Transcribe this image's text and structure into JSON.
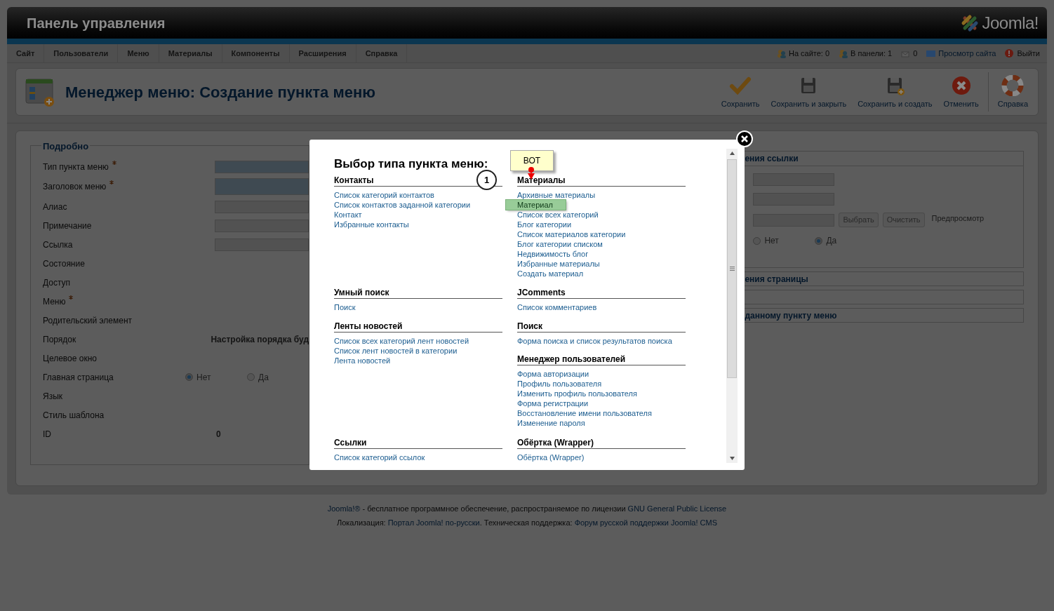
{
  "header": {
    "title": "Панель управления",
    "logo_text": "Joomla!"
  },
  "nav": [
    {
      "label": "Сайт"
    },
    {
      "label": "Пользователи"
    },
    {
      "label": "Меню"
    },
    {
      "label": "Материалы"
    },
    {
      "label": "Компоненты"
    },
    {
      "label": "Расширения"
    },
    {
      "label": "Справка"
    }
  ],
  "status": [
    {
      "kind": "users",
      "text": "На сайте: 0"
    },
    {
      "kind": "admins",
      "text": "В панели: 1"
    },
    {
      "kind": "messages",
      "text": "0"
    },
    {
      "kind": "site",
      "text": "Просмотр сайта"
    },
    {
      "kind": "logout",
      "text": "Выйти"
    }
  ],
  "toolbar": {
    "title": "Менеджер меню: Создание пункта меню",
    "buttons": [
      {
        "kind": "check",
        "label": "Сохранить"
      },
      {
        "kind": "save",
        "label": "Сохранить и закрыть"
      },
      {
        "kind": "save_new",
        "label": "Сохранить и создать"
      },
      {
        "kind": "cancel",
        "label": "Отменить"
      },
      {
        "kind": "help",
        "label": "Справка"
      }
    ]
  },
  "details": {
    "legend": "Подробно",
    "fields": [
      {
        "label": "Тип пункта меню",
        "required": true,
        "kind": "input_required"
      },
      {
        "label": "Заголовок меню",
        "required": true,
        "kind": "input_required_tall"
      },
      {
        "label": "Алиас",
        "required": false,
        "kind": "input"
      },
      {
        "label": "Примечание",
        "required": false,
        "kind": "input"
      },
      {
        "label": "Ссылка",
        "required": false,
        "kind": "input"
      },
      {
        "label": "Состояние",
        "required": false,
        "kind": "none"
      },
      {
        "label": "Доступ",
        "required": false,
        "kind": "none"
      },
      {
        "label": "Меню",
        "required": true,
        "kind": "none"
      },
      {
        "label": "Родительский элемент",
        "required": false,
        "kind": "none"
      },
      {
        "label": "Порядок",
        "required": false,
        "kind": "text",
        "value": "Настройка порядка буд"
      },
      {
        "label": "Целевое окно",
        "required": false,
        "kind": "none"
      },
      {
        "label": "Главная страница",
        "required": false,
        "kind": "radio",
        "options": [
          {
            "label": "Нет",
            "selected": true
          },
          {
            "label": "Да",
            "selected": false
          }
        ]
      },
      {
        "label": "Язык",
        "required": false,
        "kind": "none"
      },
      {
        "label": "Стиль шаблона",
        "required": false,
        "kind": "none"
      },
      {
        "label": "ID",
        "required": false,
        "kind": "text",
        "value": "0"
      }
    ]
  },
  "side_panels": [
    {
      "title": "ения ссылки",
      "kind": "link_options",
      "buttons": [
        "Выбрать",
        "Очистить"
      ],
      "preview_label": "Предпросмотр",
      "options": [
        {
          "label": "Нет",
          "selected": false
        },
        {
          "label": "Да",
          "selected": true
        }
      ]
    },
    {
      "title": "ения страницы",
      "kind": "collapsed"
    },
    {
      "kind": "empty"
    },
    {
      "title": "данному пункту меню",
      "kind": "collapsed"
    }
  ],
  "modal": {
    "title": "Выбор типа пункта меню:",
    "note": "ВОТ",
    "step": "1",
    "rows": [
      {
        "left": [
          {
            "heading": "Контакты",
            "items": [
              {
                "label": "Список категорий контактов",
                "highlighted": false
              },
              {
                "label": "Список контактов заданной категории",
                "highlighted": false
              },
              {
                "label": "Контакт",
                "highlighted": false
              },
              {
                "label": "Избранные контакты",
                "highlighted": false
              }
            ]
          }
        ],
        "right": [
          {
            "heading": "Материалы",
            "items": [
              {
                "label": "Архивные материалы",
                "highlighted": false
              },
              {
                "label": "Материал",
                "highlighted": true
              },
              {
                "label": "Список всех категорий",
                "highlighted": false
              },
              {
                "label": "Блог категории",
                "highlighted": false
              },
              {
                "label": "Список материалов категории",
                "highlighted": false
              },
              {
                "label": "Блог категории списком",
                "highlighted": false
              },
              {
                "label": "Недвижимость блог",
                "highlighted": false
              },
              {
                "label": "Избранные материалы",
                "highlighted": false
              },
              {
                "label": "Создать материал",
                "highlighted": false
              }
            ]
          }
        ]
      },
      {
        "left": [
          {
            "heading": "Умный поиск",
            "items": [
              {
                "label": "Поиск",
                "highlighted": false
              }
            ]
          }
        ],
        "right": [
          {
            "heading": "JComments",
            "items": [
              {
                "label": "Список комментариев",
                "highlighted": false
              }
            ]
          }
        ]
      },
      {
        "left": [
          {
            "heading": "Ленты новостей",
            "items": [
              {
                "label": "Список всех категорий лент новостей",
                "highlighted": false
              },
              {
                "label": "Список лент новостей в категории",
                "highlighted": false
              },
              {
                "label": "Лента новостей",
                "highlighted": false
              }
            ]
          }
        ],
        "right": [
          {
            "heading": "Поиск",
            "items": [
              {
                "label": "Форма поиска и список результатов поиска",
                "highlighted": false
              }
            ]
          },
          {
            "heading": "Менеджер пользователей",
            "items": [
              {
                "label": "Форма авторизации",
                "highlighted": false
              },
              {
                "label": "Профиль пользователя",
                "highlighted": false
              },
              {
                "label": "Изменить профиль пользователя",
                "highlighted": false
              },
              {
                "label": "Форма регистрации",
                "highlighted": false
              },
              {
                "label": "Восстановление имени пользователя",
                "highlighted": false
              },
              {
                "label": "Изменение пароля",
                "highlighted": false
              }
            ]
          }
        ]
      },
      {
        "left": [
          {
            "heading": "Ссылки",
            "items": [
              {
                "label": "Список категорий ссылок",
                "highlighted": false
              }
            ]
          }
        ],
        "right": [
          {
            "heading": "Обёртка (Wrapper)",
            "items": [
              {
                "label": "Обёртка (Wrapper)",
                "highlighted": false
              }
            ]
          }
        ]
      }
    ]
  },
  "footer": [
    [
      {
        "text": "Joomla!®",
        "link": true
      },
      {
        "text": " - бесплатное программное обеспечение, распространяемое по лицензии ",
        "link": false
      },
      {
        "text": "GNU General Public License",
        "link": true
      }
    ],
    [
      {
        "text": "Локализация: ",
        "link": false
      },
      {
        "text": "Портал Joomla! по-русски",
        "link": true
      },
      {
        "text": ". Техническая поддержка: ",
        "link": false
      },
      {
        "text": "Форум русской поддержки Joomla! CMS",
        "link": true
      }
    ]
  ]
}
